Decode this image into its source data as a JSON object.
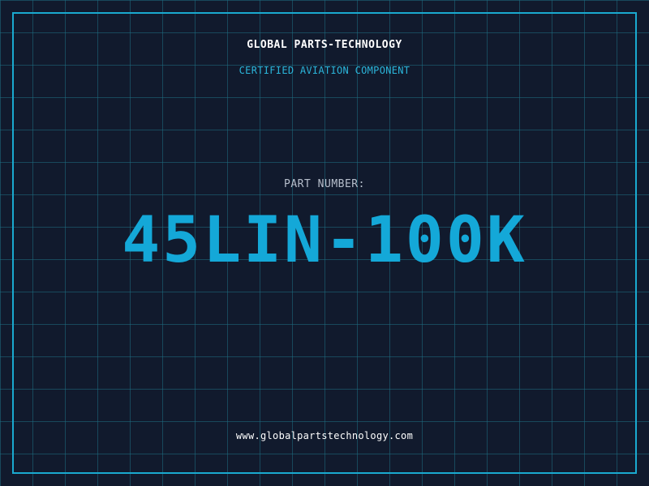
{
  "header": {
    "company_name": "GLOBAL PARTS-TECHNOLOGY",
    "tagline": "CERTIFIED AVIATION COMPONENT"
  },
  "part": {
    "label": "PART NUMBER:",
    "number": "45LIN-100K"
  },
  "footer": {
    "website": "www.globalpartstechnology.com"
  },
  "colors": {
    "background": "#111a2d",
    "accent": "#14a8d8",
    "grid": "#1e6e82",
    "text_primary": "#ffffff",
    "text_secondary": "#b7bfcc"
  }
}
